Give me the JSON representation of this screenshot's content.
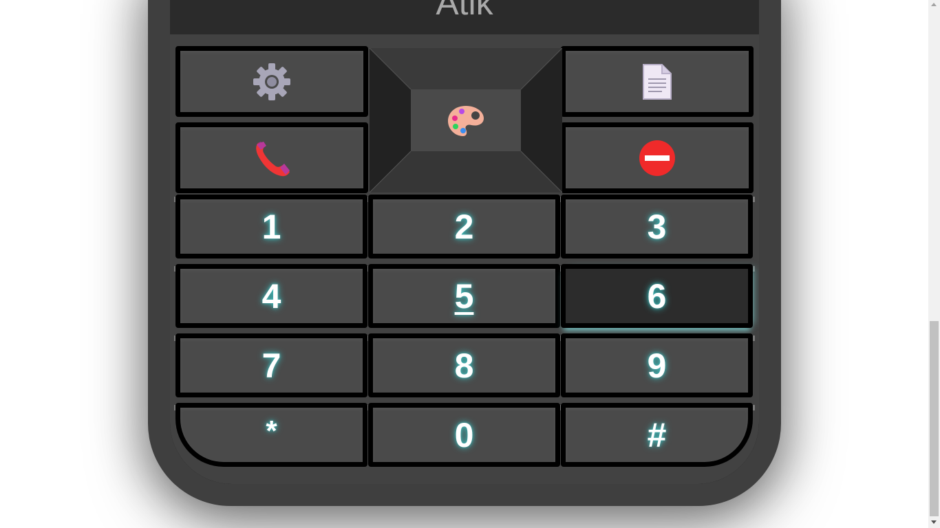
{
  "brand": "Atik",
  "function_keys": {
    "settings": "gear-icon",
    "notes": "document-icon",
    "call": "phone-icon",
    "end": "no-entry-icon",
    "center": "palette-icon"
  },
  "keys": [
    "1",
    "2",
    "3",
    "4",
    "5",
    "6",
    "7",
    "8",
    "9",
    "*",
    "0",
    "#"
  ],
  "colors": {
    "body": "#3f3f3f",
    "key": "#4a4a4a",
    "key_border": "#000000",
    "glow": "#3cd2d2",
    "active_key": "#2c2c2c",
    "brand_text": "#a9a9a9"
  },
  "state": {
    "focused_key": "5",
    "pressed_key": "6"
  }
}
